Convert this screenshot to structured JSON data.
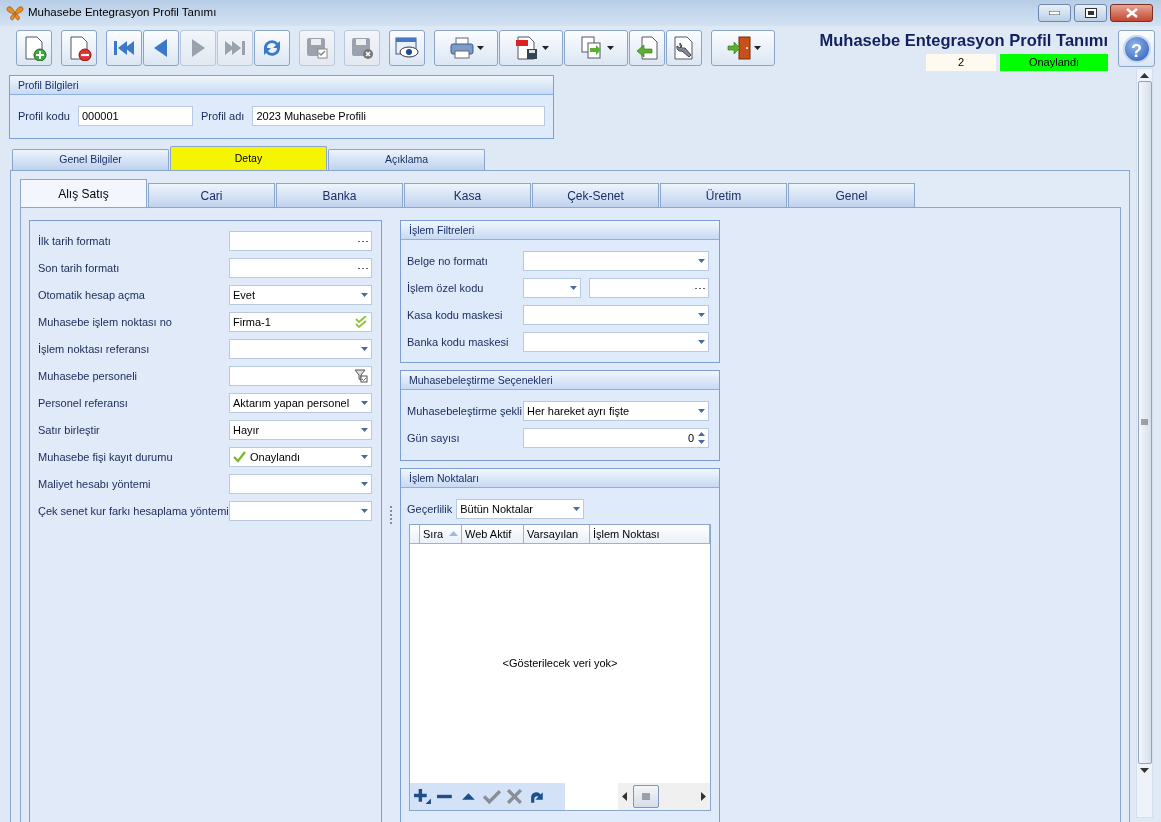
{
  "window": {
    "title": "Muhasebe Entegrasyon Profil Tanımı"
  },
  "toolbar": [
    [
      {
        "kind": "new",
        "disabled": false,
        "dropdown": false
      }
    ],
    [
      {
        "kind": "delete",
        "disabled": false,
        "dropdown": false
      }
    ],
    [
      {
        "kind": "first",
        "disabled": false,
        "dropdown": false
      },
      {
        "kind": "prev",
        "disabled": false,
        "dropdown": false
      },
      {
        "kind": "next",
        "disabled": true,
        "dropdown": false
      },
      {
        "kind": "last",
        "disabled": true,
        "dropdown": false
      },
      {
        "kind": "refresh",
        "disabled": false,
        "dropdown": false
      }
    ],
    [
      {
        "kind": "save",
        "disabled": true,
        "dropdown": false
      }
    ],
    [
      {
        "kind": "saveclose",
        "disabled": true,
        "dropdown": false
      }
    ],
    [
      {
        "kind": "preview",
        "disabled": false,
        "dropdown": false
      }
    ],
    [
      {
        "kind": "print",
        "disabled": false,
        "dropdown": true
      },
      {
        "kind": "pdf",
        "disabled": false,
        "dropdown": true
      },
      {
        "kind": "export",
        "disabled": false,
        "dropdown": true
      },
      {
        "kind": "import",
        "disabled": false,
        "dropdown": false
      },
      {
        "kind": "settings",
        "disabled": false,
        "dropdown": false
      }
    ],
    [
      {
        "kind": "exit",
        "disabled": false,
        "dropdown": true
      }
    ]
  ],
  "header": {
    "title": "Muhasebe Entegrasyon Profil Tanımı",
    "record_no": "2",
    "status": "Onaylandı",
    "help": "?"
  },
  "profile": {
    "title": "Profil Bilgileri",
    "fields": [
      {
        "label": "Profil kodu",
        "value": "000001"
      },
      {
        "label": "Profil adı",
        "value": "2023 Muhasebe Profili"
      }
    ]
  },
  "outer_tabs": [
    {
      "label": "Genel Bilgiler",
      "selected": false
    },
    {
      "label": "Detay",
      "selected": true
    },
    {
      "label": "Açıklama",
      "selected": false
    }
  ],
  "inner_tabs": [
    {
      "label": "Alış Satış",
      "selected": true
    },
    {
      "label": "Cari",
      "selected": false
    },
    {
      "label": "Banka",
      "selected": false
    },
    {
      "label": "Kasa",
      "selected": false
    },
    {
      "label": "Çek-Senet",
      "selected": false
    },
    {
      "label": "Üretim",
      "selected": false
    },
    {
      "label": "Genel",
      "selected": false
    }
  ],
  "left_fields": [
    {
      "label": "İlk tarih formatı",
      "inputs": [
        {
          "kind": "ellipsis"
        }
      ]
    },
    {
      "label": "Son tarih formatı",
      "inputs": [
        {
          "kind": "ellipsis"
        }
      ]
    },
    {
      "label": "Otomatik hesap açma",
      "inputs": [
        {
          "kind": "dropdown",
          "value": "Evet"
        }
      ]
    },
    {
      "label": "Muhasebe işlem noktası no",
      "inputs": [
        {
          "kind": "validated",
          "value": "Firma-1"
        }
      ]
    },
    {
      "label": "İşlem noktası referansı",
      "inputs": [
        {
          "kind": "dropdown"
        }
      ]
    },
    {
      "label": "Muhasebe personeli",
      "inputs": [
        {
          "kind": "lookup"
        }
      ]
    },
    {
      "label": "Personel referansı",
      "inputs": [
        {
          "kind": "dropdown",
          "value": "Aktarım yapan personel"
        }
      ]
    },
    {
      "label": "Satır birleştir",
      "inputs": [
        {
          "kind": "dropdown",
          "value": "Hayır"
        }
      ]
    },
    {
      "label": "Muhasebe fişi kayıt durumu",
      "inputs": [
        {
          "kind": "status",
          "value": "Onaylandı"
        }
      ]
    },
    {
      "label": "Maliyet hesabı yöntemi",
      "inputs": [
        {
          "kind": "dropdown"
        }
      ]
    },
    {
      "label": "Çek senet kur farkı hesaplama yöntemi",
      "inputs": [
        {
          "kind": "dropdown"
        }
      ]
    }
  ],
  "filters": {
    "title": "İşlem Filtreleri",
    "fields": [
      {
        "label": "Belge no formatı",
        "inputs": [
          {
            "kind": "dropdown"
          }
        ]
      },
      {
        "label": "İşlem özel kodu",
        "inputs": [
          {
            "kind": "dropdown"
          },
          {
            "kind": "ellipsis"
          }
        ]
      },
      {
        "label": "Kasa kodu maskesi",
        "inputs": [
          {
            "kind": "dropdown"
          }
        ]
      },
      {
        "label": "Banka kodu maskesi",
        "inputs": [
          {
            "kind": "dropdown"
          }
        ]
      }
    ]
  },
  "posting": {
    "title": "Muhasebeleştirme Seçenekleri",
    "fields": [
      {
        "label": "Muhasebeleştirme şekli",
        "inputs": [
          {
            "kind": "dropdown",
            "value": "Her hareket ayrı fişte"
          }
        ]
      },
      {
        "label": "Gün sayısı",
        "inputs": [
          {
            "kind": "spin",
            "value": "0"
          }
        ]
      }
    ]
  },
  "points": {
    "title": "İşlem Noktaları",
    "filter_label": "Geçerlilik",
    "filter_value": "Bütün Noktalar",
    "columns": [
      {
        "label": "Sıra",
        "sorted": true
      },
      {
        "label": "Web Aktif",
        "sorted": false
      },
      {
        "label": "Varsayılan",
        "sorted": false
      },
      {
        "label": "İşlem Noktası",
        "sorted": false
      }
    ],
    "empty_text": "<Gösterilecek veri yok>",
    "navigator": [
      {
        "kind": "add",
        "disabled": false
      },
      {
        "kind": "remove",
        "disabled": false
      },
      {
        "kind": "up",
        "disabled": false
      },
      {
        "kind": "confirm",
        "disabled": true
      },
      {
        "kind": "cancel",
        "disabled": true
      },
      {
        "kind": "redo",
        "disabled": false
      }
    ]
  }
}
